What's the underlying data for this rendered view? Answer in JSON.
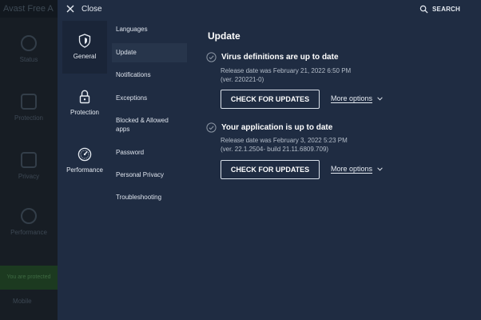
{
  "background_app": {
    "title": "Avast Free A",
    "nav": [
      "Status",
      "Protection",
      "Privacy",
      "Performance"
    ],
    "status_text": "You are protected",
    "mobile_label": "Mobile"
  },
  "header": {
    "close_label": "Close",
    "search_label": "SEARCH"
  },
  "categories": [
    {
      "label": "General",
      "icon": "shield-icon",
      "active": true
    },
    {
      "label": "Protection",
      "icon": "lock-icon",
      "active": false
    },
    {
      "label": "Performance",
      "icon": "gauge-icon",
      "active": false
    }
  ],
  "submenu": [
    "Languages",
    "Update",
    "Notifications",
    "Exceptions",
    "Blocked & Allowed apps",
    "Password",
    "Personal Privacy",
    "Troubleshooting"
  ],
  "submenu_active": "Update",
  "content": {
    "title": "Update",
    "sections": [
      {
        "title": "Virus definitions are up to date",
        "release": "Release date was February 21, 2022 6:50 PM",
        "version": "(ver. 220221-0)",
        "button": "CHECK FOR UPDATES",
        "more": "More options"
      },
      {
        "title": "Your application is up to date",
        "release": "Release date was February 3, 2022 5:23 PM",
        "version": "(ver. 22.1.2504- build 21.11.6809.709)",
        "button": "CHECK FOR UPDATES",
        "more": "More options"
      }
    ]
  },
  "colors": {
    "overlay_bg": "#1f2c42",
    "active_category_bg": "#1a2538",
    "active_submenu_bg": "#27354b",
    "text": "#e6ebf2",
    "muted_text": "#b4bdc9"
  }
}
